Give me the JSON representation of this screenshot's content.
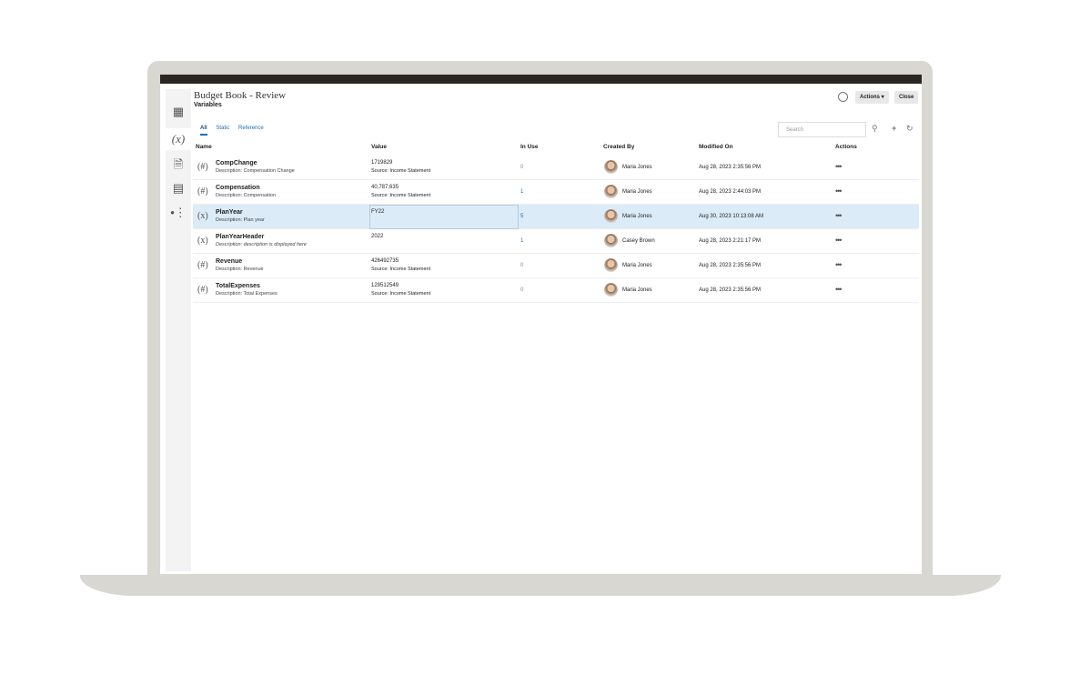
{
  "header": {
    "title": "Budget Book - Review",
    "subtitle": "Variables",
    "actions_label": "Actions ▾",
    "close_label": "Close"
  },
  "tabs": [
    "All",
    "Static",
    "Reference"
  ],
  "search": {
    "placeholder": "Search"
  },
  "columns": [
    "Name",
    "Value",
    "In Use",
    "Created By",
    "Modified On",
    "Actions"
  ],
  "rows": [
    {
      "type": "(#)",
      "name": "CompChange",
      "desc": "Description:  Compensation Change",
      "value": "1719829",
      "source": "Source:  Income Statement",
      "in_use": "0",
      "created_by": "Maria Jones",
      "modified": "Aug 28, 2023 2:35:56 PM",
      "actions": "•••"
    },
    {
      "type": "(#)",
      "name": "Compensation",
      "desc": "Description:  Compensation",
      "value": "40,787,635",
      "source": "Source:  Income Statement",
      "in_use": "1",
      "created_by": "Maria Jones",
      "modified": "Aug 28, 2023 2:44:03 PM",
      "actions": "•••"
    },
    {
      "type": "(x)",
      "name": "PlanYear",
      "desc": "Description:  Plan year",
      "value": "FY22",
      "source": "",
      "in_use": "5",
      "created_by": "Maria Jones",
      "modified": "Aug 30, 2023 10:13:08 AM",
      "actions": "•••"
    },
    {
      "type": "(x)",
      "name": "PlanYearHeader",
      "desc": "Description:  description is displayed here",
      "value": "2022",
      "source": "",
      "in_use": "1",
      "created_by": "Casey Brown",
      "modified": "Aug 28, 2023 2:21:17 PM",
      "actions": "•••"
    },
    {
      "type": "(#)",
      "name": "Revenue",
      "desc": "Description:  Revenue",
      "value": "426492735",
      "source": "Source:  Income Statement",
      "in_use": "0",
      "created_by": "Maria Jones",
      "modified": "Aug 28, 2023 2:35:56 PM",
      "actions": "•••"
    },
    {
      "type": "(#)",
      "name": "TotalExpenses",
      "desc": "Description:  Total Expenses",
      "value": "129512549",
      "source": "Source:  Income Statement",
      "in_use": "0",
      "created_by": "Maria Jones",
      "modified": "Aug 28, 2023 2:35:56 PM",
      "actions": "•••"
    }
  ],
  "selected_row": 2,
  "accent": "#1a6fae"
}
